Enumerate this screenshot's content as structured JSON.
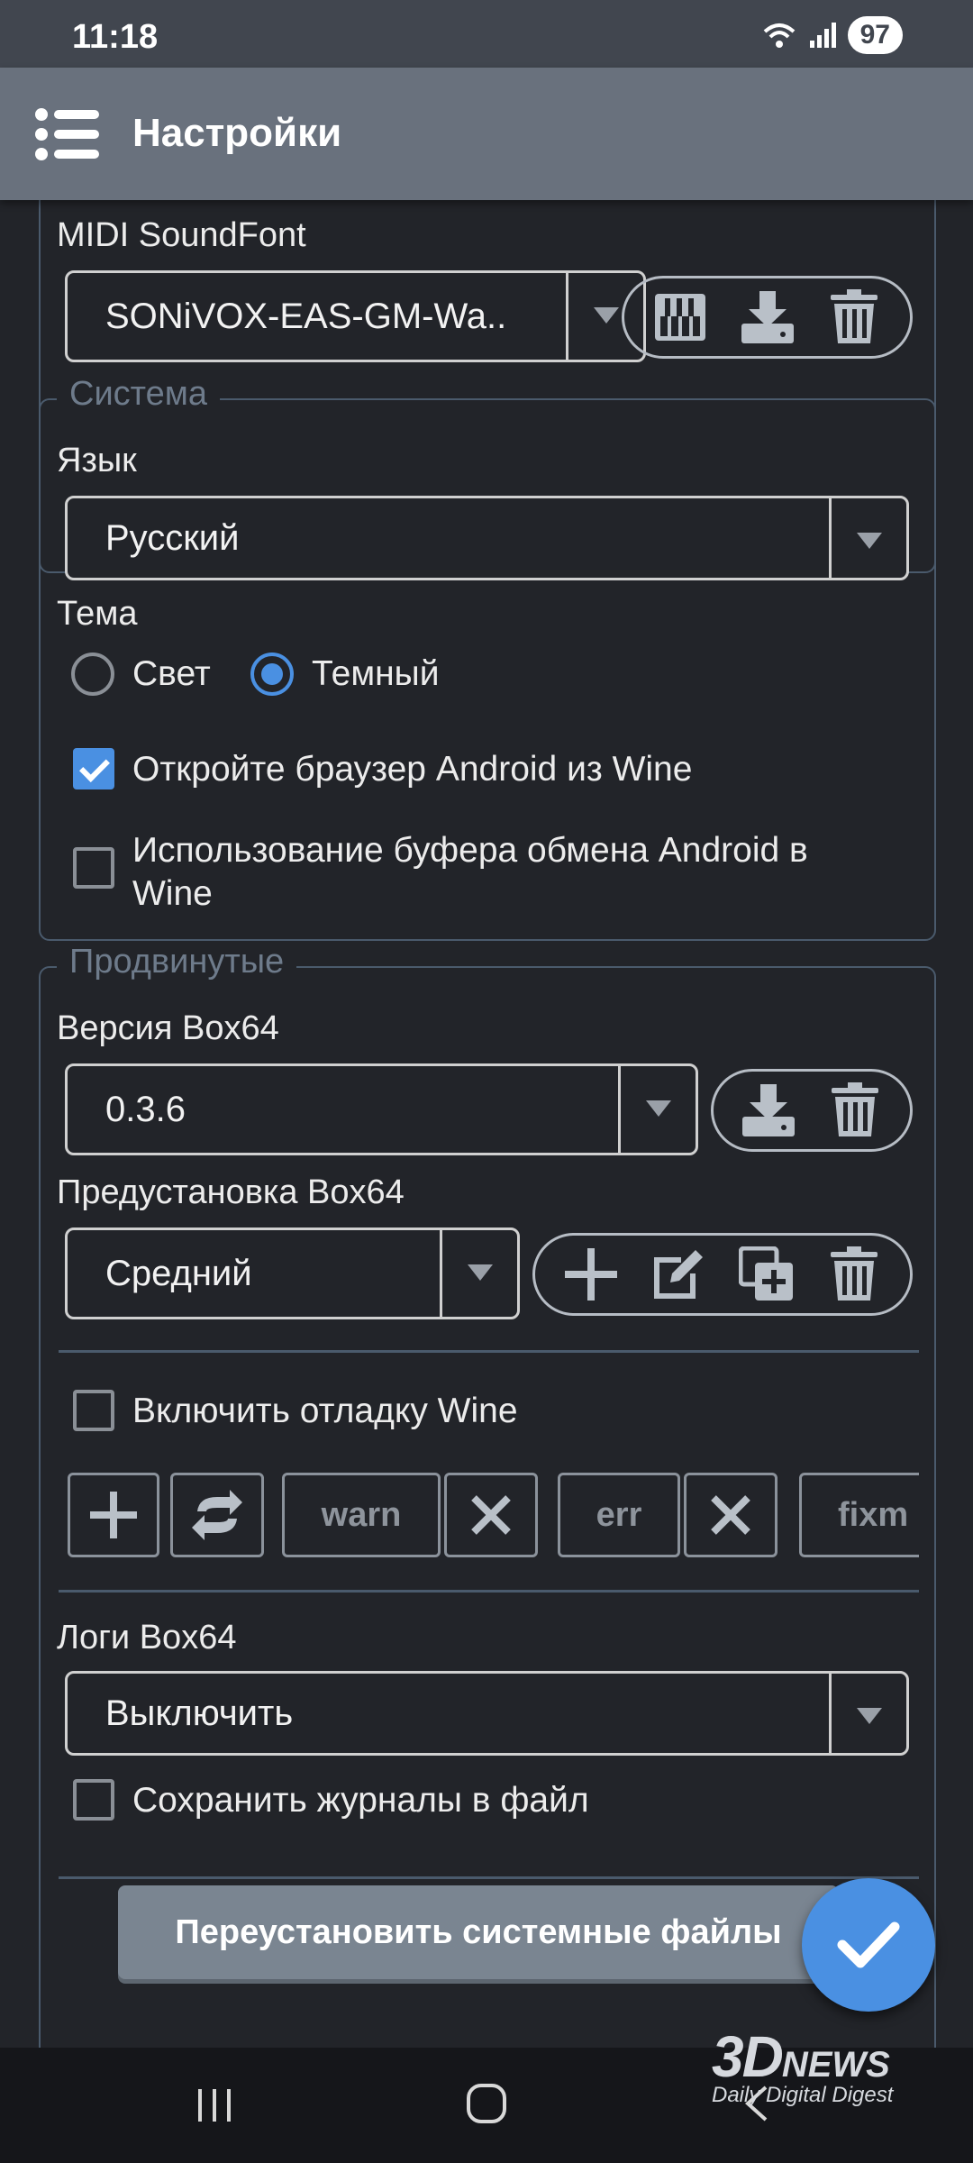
{
  "status_bar": {
    "time": "11:18",
    "battery": "97"
  },
  "app_bar": {
    "title": "Настройки"
  },
  "audio": {
    "soundfont_label": "MIDI SoundFont",
    "soundfont_value": "SONiVOX-EAS-GM-Wa.."
  },
  "system": {
    "legend": "Система",
    "language_label": "Язык",
    "language_value": "Русский",
    "theme_label": "Тема",
    "theme_light": "Свет",
    "theme_dark": "Темный",
    "open_browser": "Откройте браузер Android из Wine",
    "clipboard_line1": "Использование буфера обмена Android в",
    "clipboard_line2": "Wine"
  },
  "advanced": {
    "legend": "Продвинутые",
    "box64_version_label": "Версия Box64",
    "box64_version_value": "0.3.6",
    "box64_preset_label": "Предустановка Box64",
    "box64_preset_value": "Средний",
    "wine_debug_label": "Включить отладку Wine",
    "debug_channels": [
      "warn",
      "err",
      "fixm"
    ],
    "box64_logs_label": "Логи Box64",
    "box64_logs_value": "Выключить",
    "save_logs_label": "Сохранить журналы в файл",
    "reinstall_button": "Переустановить системные файлы"
  },
  "watermark": {
    "brand": "3D",
    "brand2": "NEWS",
    "tagline": "Daily Digital Digest"
  },
  "icons": [
    "menu-icon",
    "piano-icon",
    "download-icon",
    "trash-icon",
    "plus-icon",
    "edit-icon",
    "copy-icon",
    "sync-icon",
    "close-icon",
    "check-icon"
  ],
  "colors": {
    "accent": "#4a90e2",
    "appbar": "#69717d",
    "background": "#222429",
    "border": "#4a5a6c"
  }
}
